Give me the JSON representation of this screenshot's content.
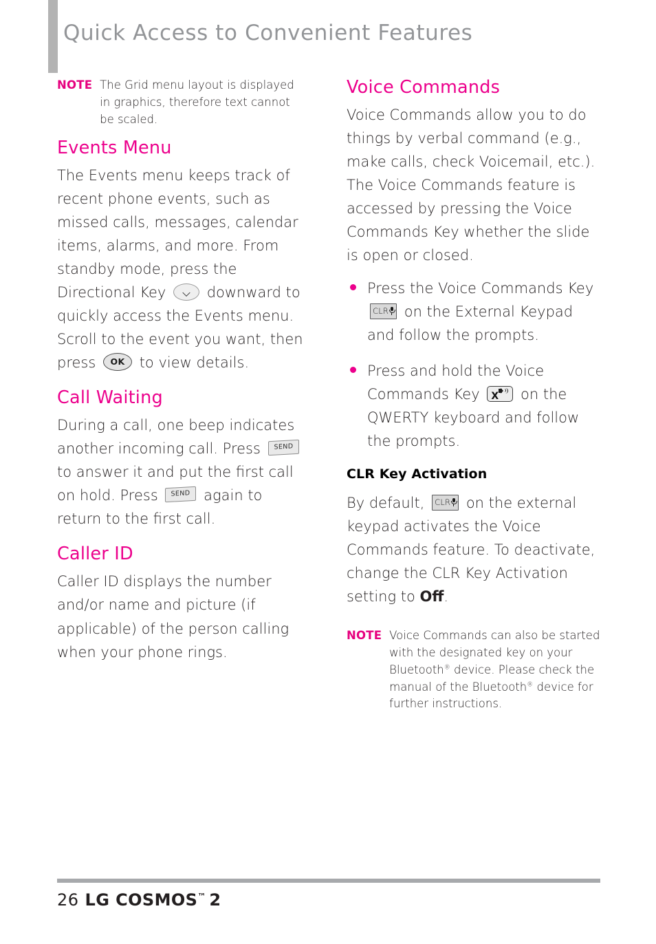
{
  "page": {
    "title": "Quick Access to Convenient Features",
    "accent_pink": "#ec008c",
    "title_gray": "#939598",
    "body_color": "#231f20"
  },
  "left_column": {
    "note": {
      "label": "NOTE",
      "text": "The Grid menu layout is displayed in graphics, therefore text cannot be scaled."
    },
    "events_menu": {
      "heading": "Events Menu",
      "text_1": "The Events menu keeps track of recent phone events, such as missed calls, messages, calendar items, alarms, and more.  From standby mode, press the Directional Key",
      "key_directional": "directional-down-key",
      "text_2": "downward to quickly access the Events menu. Scroll to the event you want, then press",
      "key_ok": "OK",
      "text_3": "to view details."
    },
    "call_waiting": {
      "heading": "Call Waiting",
      "text_1": "During a call, one beep indicates another incoming call. Press",
      "key_send_1": "SEND",
      "text_2": "to answer it and put the first call on hold. Press",
      "key_send_2": "SEND",
      "text_3": "again to return to the first call."
    },
    "caller_id": {
      "heading": "Caller ID",
      "text": "Caller ID displays the number and/or name and picture (if applicable) of the person calling when your phone rings."
    }
  },
  "right_column": {
    "voice_commands": {
      "heading": "Voice Commands",
      "paragraph": "Voice Commands allow you to do things by verbal command (e.g., make calls, check Voicemail, etc.). The Voice Commands feature is accessed by pressing the Voice Commands Key whether the slide is open or closed.",
      "bullets": [
        {
          "text_1": "Press the Voice Commands Key",
          "key_label": "CLR",
          "key_icon": "microphone-icon",
          "text_2": "on the External Keypad and follow the prompts."
        },
        {
          "text_1": "Press and hold the Voice Commands Key",
          "key_label": "X",
          "key_icon": "speaker-icon",
          "text_2": "on the QWERTY keyboard and follow the prompts."
        }
      ]
    },
    "clr_key_activation": {
      "heading": "CLR Key Activation",
      "text_1": "By default,",
      "key_label": "CLR",
      "key_icon": "microphone-icon",
      "text_2": "on the external keypad activates the Voice Commands feature. To deactivate, change the CLR Key Activation setting to",
      "bold_value": "Off",
      "text_3": "."
    },
    "note": {
      "label": "NOTE",
      "text_1": "Voice Commands can also be started with the designated key on your Bluetooth",
      "reg_1": "®",
      "text_2": " device. Please check the manual of the Bluetooth",
      "reg_2": "®",
      "text_3": " device for further instructions."
    }
  },
  "footer": {
    "page_number": "26",
    "brand": "LG COSMOS",
    "trademark": "™",
    "model": "2"
  }
}
